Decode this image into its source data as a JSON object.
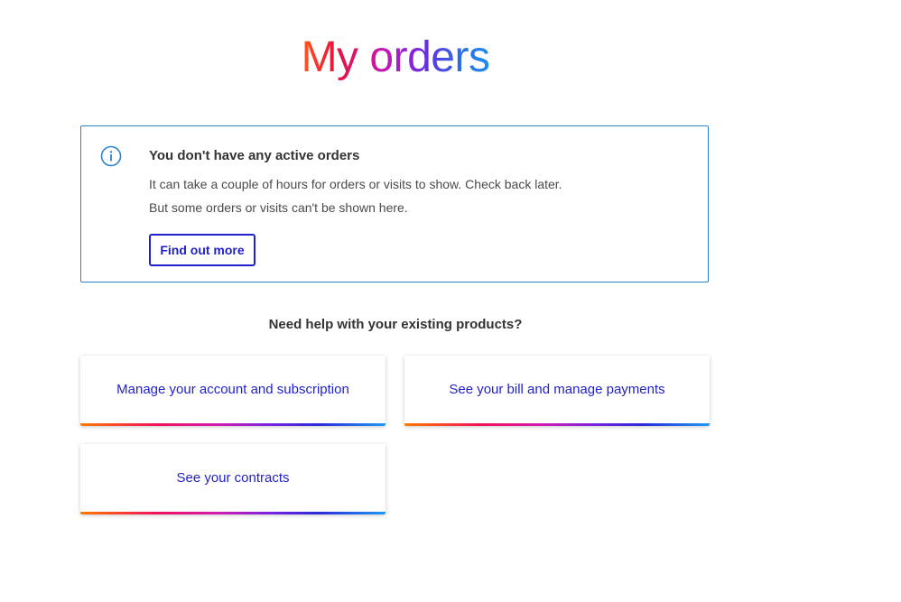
{
  "page": {
    "title": "My orders"
  },
  "notice": {
    "icon": "info-circle-icon",
    "heading": "You don't have any active orders",
    "line1": "It can take a couple of hours for orders or visits to show. Check back later.",
    "line2": "But some orders or visits can't be shown here.",
    "button_label": "Find out more"
  },
  "help": {
    "heading": "Need help with your existing products?",
    "cards": [
      {
        "label": "Manage your account and subscription"
      },
      {
        "label": "See your bill and manage payments"
      },
      {
        "label": "See your contracts"
      }
    ]
  },
  "colors": {
    "accent_blue": "#1f1fcc",
    "notice_border": "#2a84c5",
    "text_dark": "#333333"
  }
}
